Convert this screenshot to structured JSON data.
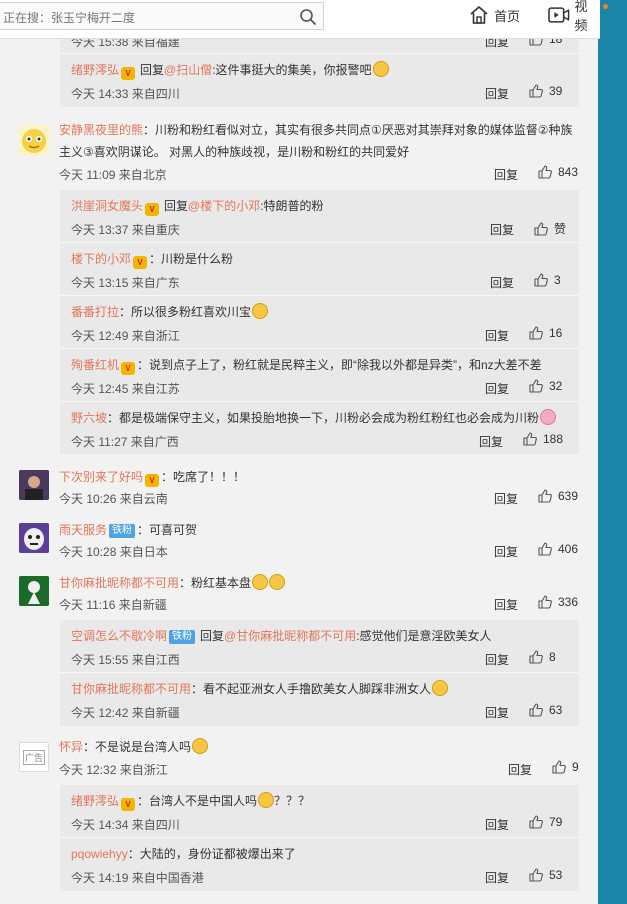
{
  "topbar": {
    "search_placeholder": "正在搜：张玉宁梅开二度",
    "nav_home": "首页",
    "nav_video": "视频"
  },
  "labels": {
    "reply": "回复",
    "reply_to_prefix": "回复"
  },
  "colors": {
    "username": "#e2765a",
    "fan_badge": "#4fa3e0",
    "side_band": "#1a85a7"
  },
  "c0": {
    "meta": "今天 15:38 来自福建",
    "likes": "18"
  },
  "c1": {
    "name": "绪野澪弘",
    "reply_to": "@扫山僧",
    "text": ":这件事挺大的集美，你报警吧",
    "meta": "今天 14:33 来自四川",
    "likes": "39"
  },
  "c2": {
    "name": "安静黑夜里的熊",
    "line1": "：川粉和粉红看似对立，其实有很多共同点①厌恶对其崇拜对象的媒体监督②种族",
    "line2": "主义③喜欢阴谋论。 对黑人的种族歧视，是川粉和粉红的共同爱好",
    "meta": "今天 11:09 来自北京",
    "likes": "843"
  },
  "c3": {
    "name": "洪崖洞女魔头",
    "reply_to": "@楼下的小邓",
    "text": ":特朗普的粉",
    "meta": "今天 13:37 来自重庆",
    "likes": "赞"
  },
  "c4": {
    "name": "楼下的小邓",
    "text": "：川粉是什么粉",
    "meta": "今天 13:15 来自广东",
    "likes": "3"
  },
  "c5": {
    "name": "番番打拉",
    "text": "：所以很多粉红喜欢川宝",
    "meta": "今天 12:49 来自浙江",
    "likes": "16"
  },
  "c6": {
    "name": "殉番红机",
    "text": "：说到点子上了，粉红就是民粹主义，即“除我以外都是异类”，和nz大差不差",
    "meta": "今天 12:45 来自江苏",
    "likes": "32"
  },
  "c7": {
    "name": "野六坡",
    "text": "：都是极端保守主义，如果投胎地换一下，川粉必会成为粉红粉红也必会成为川粉",
    "meta": "今天 11:27 来自广西",
    "likes": "188"
  },
  "c8": {
    "name": "下次别来了好吗",
    "text": "：吃席了！！！",
    "meta": "今天 10:26 来自云南",
    "likes": "639"
  },
  "c9": {
    "name": "雨天服务",
    "badge": "铁粉",
    "text": "：可喜可贺",
    "meta": "今天 10:28 来自日本",
    "likes": "406"
  },
  "c10": {
    "name": "甘你麻批昵称都不可用",
    "text": "：粉红基本盘",
    "meta": "今天 11:16 来自新疆",
    "likes": "336"
  },
  "c11": {
    "name": "空调怎么不歇冷啊",
    "badge": "铁粉",
    "reply_to": "@甘你麻批昵称都不可用",
    "text": ":感觉他们是意淫欧美女人",
    "meta": "今天 15:55 来自江西",
    "likes": "8"
  },
  "c12": {
    "name": "甘你麻批昵称都不可用",
    "text": "：看不起亚洲女人手撸欧美女人脚踩非洲女人",
    "meta": "今天 12:42 来自新疆",
    "likes": "63"
  },
  "c13": {
    "name": "怀异",
    "avatar_text": "广告",
    "text": "：不是说是台湾人吗",
    "meta": "今天 12:32 来自浙江",
    "likes": "9"
  },
  "c14": {
    "name": "绪野澪弘",
    "text": "：台湾人不是中国人吗",
    "text_tail": "？？？",
    "meta": "今天 14:34 来自四川",
    "likes": "79"
  },
  "c15": {
    "name": "pqowiehyy",
    "text": "：大陆的，身份证都被爆出来了",
    "meta": "今天 14:19 来自中国香港",
    "likes": "53"
  }
}
